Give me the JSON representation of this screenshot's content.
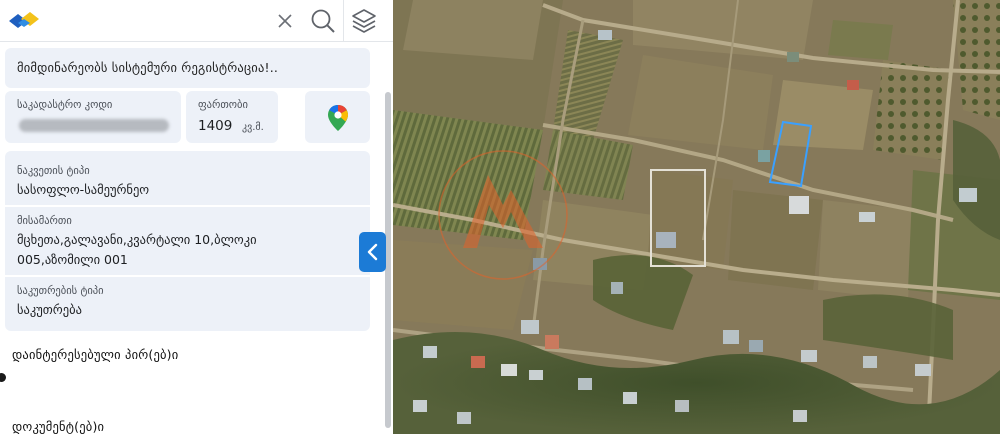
{
  "panel": {
    "notice": "მიმდინარეობს სისტემური რეგისტრაცია!..",
    "cadastral": {
      "label": "საკადასტრო კოდი",
      "value_hidden": true
    },
    "area": {
      "label": "ფართობი",
      "value": "1409",
      "unit": "კვ.მ."
    },
    "details": {
      "parcel_type_label": "ნაკვეთის ტიპი",
      "parcel_type_value": "სასოფლო-სამეურნეო",
      "address_label": "მისამართი",
      "address_line1": "მცხეთა,გალავანი,კვარტალი 10,ბლოკი",
      "address_line2": "005,აზომილი 001",
      "ownership_label": "საკუთრების ტიპი",
      "ownership_value": "საკუთრება"
    },
    "sections": {
      "interested_parties": "დაინტერესებული პირ(ებ)ი",
      "documents": "დოკუმენტ(ებ)ი"
    }
  },
  "icons": {
    "logo": "logo-icon",
    "close": "close-icon",
    "search": "search-icon",
    "layers": "layers-icon",
    "maps": "google-maps-icon",
    "collapse": "chevron-left-icon"
  },
  "colors": {
    "card_bg": "#edf1f8",
    "accent_blue": "#1c7bd6",
    "parcel_outline": "#3aa0ff",
    "watermark": "#e2622a"
  }
}
